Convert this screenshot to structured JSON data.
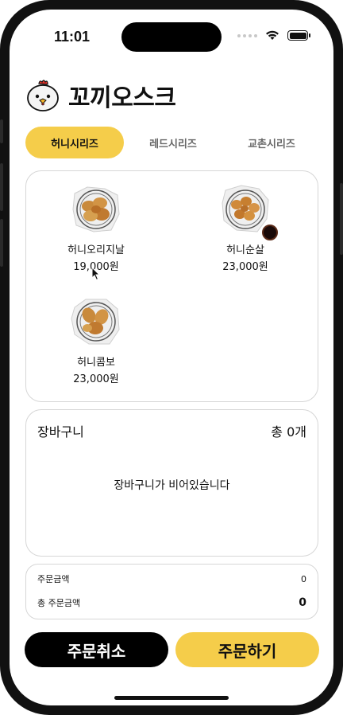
{
  "status_bar": {
    "time": "11:01"
  },
  "app": {
    "title": "꼬끼오스크"
  },
  "tabs": [
    {
      "label": "허니시리즈",
      "active": true
    },
    {
      "label": "레드시리즈",
      "active": false
    },
    {
      "label": "교촌시리즈",
      "active": false
    }
  ],
  "menu": [
    {
      "name": "허니오리지날",
      "price": "19,000원"
    },
    {
      "name": "허니순살",
      "price": "23,000원"
    },
    {
      "name": "허니콤보",
      "price": "23,000원"
    }
  ],
  "cart": {
    "title": "장바구니",
    "count": "총 0개",
    "empty_message": "장바구니가 비어있습니다"
  },
  "summary": {
    "order_amount_label": "주문금액",
    "order_amount_value": "0",
    "total_amount_label": "총 주문금액",
    "total_amount_value": "0"
  },
  "actions": {
    "cancel_label": "주문취소",
    "order_label": "주문하기"
  },
  "colors": {
    "accent": "#f5cd4a",
    "dark": "#000000"
  }
}
